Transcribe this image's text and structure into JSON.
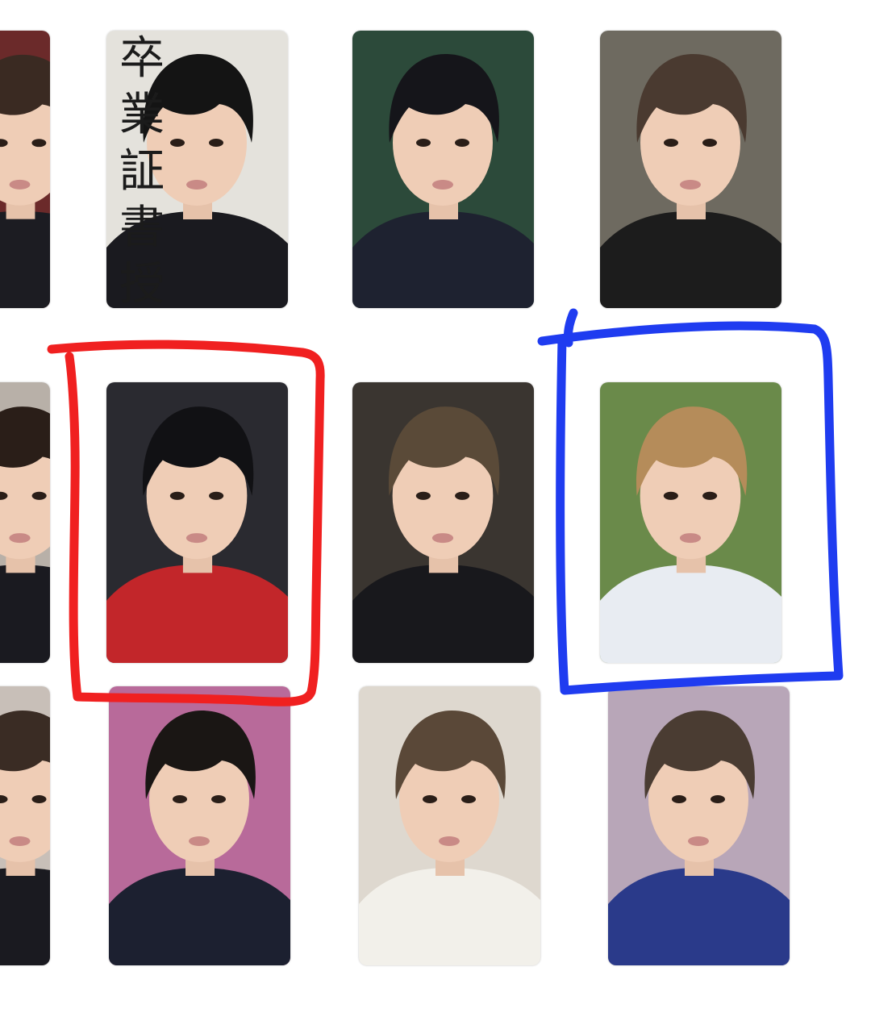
{
  "grid": {
    "columns": 5,
    "rows": 3
  },
  "cards": [
    {
      "row": 0,
      "col": 0,
      "hair": "#3a2a22",
      "bg": "#6b2a2a",
      "top": "#1c1c22",
      "note": ""
    },
    {
      "row": 0,
      "col": 1,
      "hair": "#141414",
      "bg": "#e4e2dc",
      "top": "#1a1a1f",
      "text": "卒業証書授"
    },
    {
      "row": 0,
      "col": 2,
      "hair": "#15151a",
      "bg": "#2c4a3a",
      "top": "#1e2230"
    },
    {
      "row": 0,
      "col": 3,
      "hair": "#4a3a30",
      "bg": "#6e6a60",
      "top": "#1c1c1c"
    },
    {
      "row": 1,
      "col": 0,
      "hair": "#2a1e18",
      "bg": "#b8b0a8",
      "top": "#1a1a20"
    },
    {
      "row": 1,
      "col": 1,
      "hair": "#111114",
      "bg": "#2a2a30",
      "top": "#c2262a"
    },
    {
      "row": 1,
      "col": 2,
      "hair": "#5a4a38",
      "bg": "#3a3530",
      "top": "#18181c"
    },
    {
      "row": 1,
      "col": 3,
      "hair": "#b58c5a",
      "bg": "#6a8a4a",
      "top": "#e8ecf2"
    },
    {
      "row": 2,
      "col": 0,
      "hair": "#3a2c24",
      "bg": "#c8bfb8",
      "top": "#1a1a20"
    },
    {
      "row": 2,
      "col": 1,
      "hair": "#1a1614",
      "bg": "#b86a9a",
      "top": "#1c2030"
    },
    {
      "row": 2,
      "col": 2,
      "hair": "#5a4838",
      "bg": "#ded8cf",
      "top": "#f2f0ea"
    },
    {
      "row": 2,
      "col": 3,
      "hair": "#4a3c32",
      "bg": "#b8a6b8",
      "top": "#2a3a8a"
    }
  ],
  "annotations": {
    "red_outline": {
      "color": "#f02020"
    },
    "blue_outline": {
      "color": "#1f3cf0"
    }
  }
}
